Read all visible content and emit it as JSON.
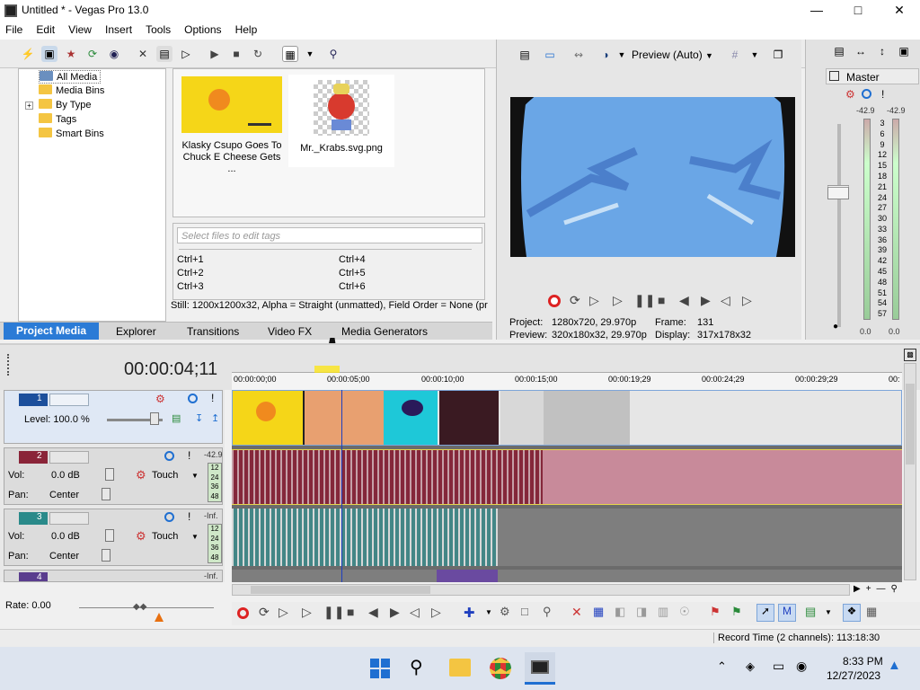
{
  "window": {
    "title": "Untitled * - Vegas Pro 13.0"
  },
  "menu": [
    "File",
    "Edit",
    "View",
    "Insert",
    "Tools",
    "Options",
    "Help"
  ],
  "media_tree": {
    "items": [
      "All Media",
      "Media Bins",
      "By Type",
      "Tags",
      "Smart Bins"
    ]
  },
  "media_files": [
    {
      "name": "Klasky Csupo Goes To Chuck E Cheese Gets ..."
    },
    {
      "name": "Mr._Krabs.svg.png"
    }
  ],
  "tags": {
    "placeholder": "Select files to edit tags",
    "shortcuts": [
      "Ctrl+1",
      "Ctrl+2",
      "Ctrl+3",
      "Ctrl+4",
      "Ctrl+5",
      "Ctrl+6"
    ]
  },
  "media_status": "Still: 1200x1200x32, Alpha = Straight (unmatted), Field Order = None (pr",
  "tabs": [
    "Project Media",
    "Explorer",
    "Transitions",
    "Video FX",
    "Media Generators"
  ],
  "preview": {
    "mode": "Preview (Auto)",
    "project_label": "Project:",
    "project_value": "1280x720, 29.970p",
    "preview_label": "Preview:",
    "preview_value": "320x180x32, 29.970p",
    "frame_label": "Frame:",
    "frame_value": "131",
    "display_label": "Display:",
    "display_value": "317x178x32"
  },
  "mixer": {
    "title": "Master",
    "peak_left": "-42.9",
    "peak_right": "-42.9",
    "scale": [
      "3",
      "6",
      "9",
      "12",
      "15",
      "18",
      "21",
      "24",
      "27",
      "30",
      "33",
      "36",
      "39",
      "42",
      "45",
      "48",
      "51",
      "54",
      "57"
    ],
    "level_left": "0.0",
    "level_right": "0.0"
  },
  "timeline": {
    "timecode": "00:00:04;11",
    "ruler": [
      "00:00:00;00",
      "00:00:05;00",
      "00:00:10;00",
      "00:00:15;00",
      "00:00:19;29",
      "00:00:24;29",
      "00:00:29;29",
      "00:"
    ]
  },
  "tracks": [
    {
      "number": "1",
      "type": "video",
      "level_label": "Level: 100.0 %"
    },
    {
      "number": "2",
      "type": "audio",
      "peak": "-42.9",
      "vol_label": "Vol:",
      "vol_value": "0.0 dB",
      "pan_label": "Pan:",
      "pan_value": "Center",
      "mode": "Touch",
      "meter": [
        "12",
        "24",
        "36",
        "48"
      ]
    },
    {
      "number": "3",
      "type": "audio",
      "peak": "-Inf.",
      "vol_label": "Vol:",
      "vol_value": "0.0 dB",
      "pan_label": "Pan:",
      "pan_value": "Center",
      "mode": "Touch",
      "meter": [
        "12",
        "24",
        "36",
        "48"
      ]
    },
    {
      "number": "4",
      "type": "audio",
      "peak": "-Inf."
    }
  ],
  "rate": "Rate: 0.00",
  "status": {
    "record_time": "Record Time (2 channels): 113:18:30"
  },
  "taskbar": {
    "time": "8:33 PM",
    "date": "12/27/2023"
  },
  "colors": {
    "accent_blue": "#1f6fd1",
    "video_track": "#1c4f9c",
    "audio_track2": "#8a2438",
    "audio_track3": "#2a8a8a",
    "audio_track4": "#5a3d8e"
  }
}
